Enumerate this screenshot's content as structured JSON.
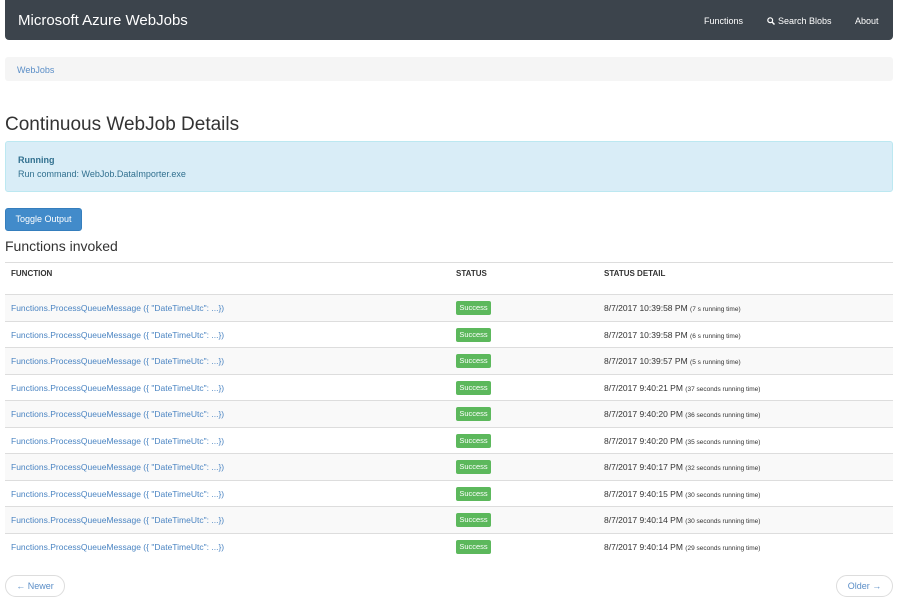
{
  "navbar": {
    "brand": "Microsoft Azure WebJobs",
    "items": [
      {
        "label": "Functions",
        "icon": ""
      },
      {
        "label": "Search Blobs",
        "icon": "search-icon"
      },
      {
        "label": "About",
        "icon": ""
      }
    ]
  },
  "breadcrumb": {
    "label": "WebJobs"
  },
  "page": {
    "title": "Continuous WebJob Details"
  },
  "status_panel": {
    "state": "Running",
    "command": "Run command: WebJob.DataImporter.exe"
  },
  "toggle_output": {
    "label": "Toggle Output"
  },
  "functions": {
    "title": "Functions invoked",
    "columns": [
      "FUNCTION",
      "STATUS",
      "STATUS DETAIL"
    ],
    "rows": [
      {
        "function": "Functions.ProcessQueueMessage ({ \"DateTimeUtc\": ...})",
        "status": "Success",
        "time": "8/7/2017 10:39:58 PM",
        "duration": "(7 s running time)"
      },
      {
        "function": "Functions.ProcessQueueMessage ({ \"DateTimeUtc\": ...})",
        "status": "Success",
        "time": "8/7/2017 10:39:58 PM",
        "duration": "(6 s running time)"
      },
      {
        "function": "Functions.ProcessQueueMessage ({ \"DateTimeUtc\": ...})",
        "status": "Success",
        "time": "8/7/2017 10:39:57 PM",
        "duration": "(5 s running time)"
      },
      {
        "function": "Functions.ProcessQueueMessage ({ \"DateTimeUtc\": ...})",
        "status": "Success",
        "time": "8/7/2017 9:40:21 PM",
        "duration": "(37 seconds running time)"
      },
      {
        "function": "Functions.ProcessQueueMessage ({ \"DateTimeUtc\": ...})",
        "status": "Success",
        "time": "8/7/2017 9:40:20 PM",
        "duration": "(36 seconds running time)"
      },
      {
        "function": "Functions.ProcessQueueMessage ({ \"DateTimeUtc\": ...})",
        "status": "Success",
        "time": "8/7/2017 9:40:20 PM",
        "duration": "(35 seconds running time)"
      },
      {
        "function": "Functions.ProcessQueueMessage ({ \"DateTimeUtc\": ...})",
        "status": "Success",
        "time": "8/7/2017 9:40:17 PM",
        "duration": "(32 seconds running time)"
      },
      {
        "function": "Functions.ProcessQueueMessage ({ \"DateTimeUtc\": ...})",
        "status": "Success",
        "time": "8/7/2017 9:40:15 PM",
        "duration": "(30 seconds running time)"
      },
      {
        "function": "Functions.ProcessQueueMessage ({ \"DateTimeUtc\": ...})",
        "status": "Success",
        "time": "8/7/2017 9:40:14 PM",
        "duration": "(30 seconds running time)"
      },
      {
        "function": "Functions.ProcessQueueMessage ({ \"DateTimeUtc\": ...})",
        "status": "Success",
        "time": "8/7/2017 9:40:14 PM",
        "duration": "(29 seconds running time)"
      }
    ]
  },
  "pager": {
    "newer": "← Newer",
    "older": "Older →"
  },
  "colors": {
    "navbar": "#3c444c",
    "link": "#4a84c2",
    "success": "#5cb85c",
    "info_bg": "#d9edf7",
    "primary": "#428bca"
  }
}
